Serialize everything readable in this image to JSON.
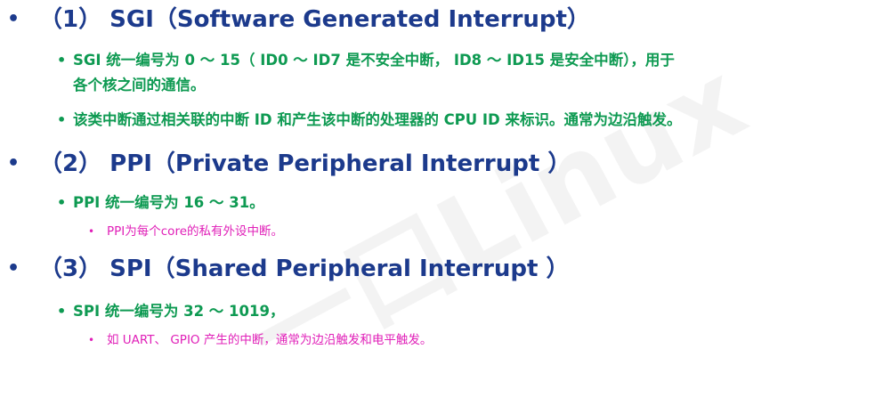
{
  "watermark": "一口Linux",
  "bullet": "•",
  "sections": [
    {
      "heading": "（1） SGI（Software Generated Interrupt）",
      "items": [
        "SGI 统一编号为 0 ～ 15（ ID0 ～ ID7 是不安全中断， ID8 ～ ID15 是安全中断），用于",
        "各个核之间的通信。",
        "该类中断通过相关联的中断 ID 和产生该中断的处理器的 CPU ID 来标识。通常为边沿触发。"
      ]
    },
    {
      "heading": "（2） PPI（Private Peripheral Interrupt ）",
      "items": [
        "PPI 统一编号为 16 ～ 31。"
      ],
      "subitems": [
        "PPI为每个core的私有外设中断。"
      ]
    },
    {
      "heading": "（3） SPI（Shared Peripheral Interrupt ）",
      "items": [
        "SPI 统一编号为 32 ～ 1019，"
      ],
      "subitems": [
        "如 UART、 GPIO 产生的中断，通常为边沿触发和电平触发。"
      ]
    }
  ]
}
